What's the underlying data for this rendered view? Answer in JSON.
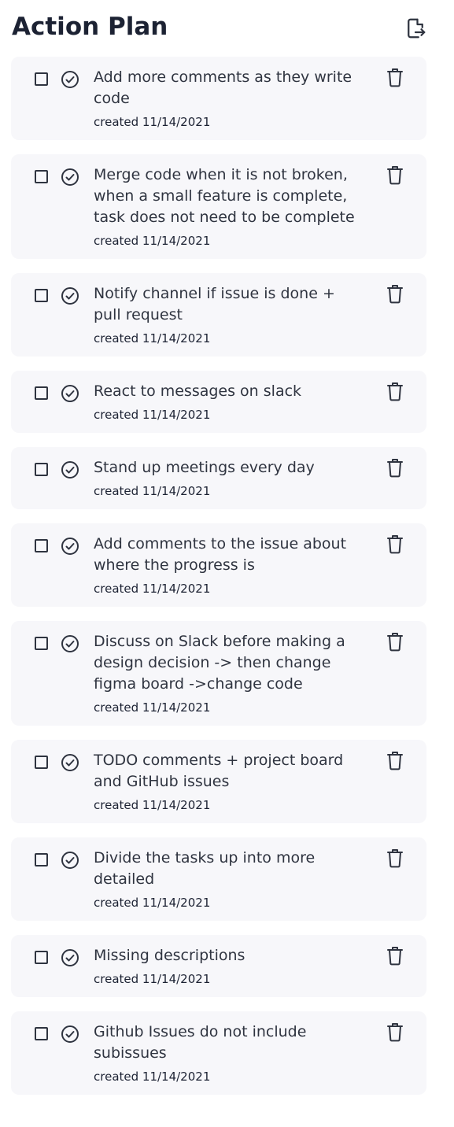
{
  "header": {
    "title": "Action Plan",
    "export_icon": "export-file-icon"
  },
  "icons": {
    "checkbox": "checkbox-unchecked",
    "complete": "check-circle-icon",
    "delete": "trash-icon"
  },
  "colors": {
    "card_background": "#f7f7fa",
    "text": "#2f3440",
    "title": "#1c2233"
  },
  "tasks": [
    {
      "text": "Add more comments as they write code",
      "created": "created 11/14/2021"
    },
    {
      "text": "Merge code when it is not broken, when a small feature is complete, task does not need to be complete",
      "created": "created 11/14/2021"
    },
    {
      "text": "Notify channel if issue is done + pull request",
      "created": "created 11/14/2021"
    },
    {
      "text": "React to messages on slack",
      "created": "created 11/14/2021"
    },
    {
      "text": "Stand up meetings every day",
      "created": "created 11/14/2021"
    },
    {
      "text": "Add comments to the issue about where the progress is",
      "created": "created 11/14/2021"
    },
    {
      "text": "Discuss on Slack before making a design decision -> then change figma board ->change code",
      "created": "created 11/14/2021"
    },
    {
      "text": "TODO comments + project board and GitHub issues",
      "created": "created 11/14/2021"
    },
    {
      "text": "Divide the tasks up into more detailed",
      "created": "created 11/14/2021"
    },
    {
      "text": "Missing descriptions",
      "created": "created 11/14/2021"
    },
    {
      "text": "Github Issues do not include subissues",
      "created": "created 11/14/2021"
    }
  ]
}
